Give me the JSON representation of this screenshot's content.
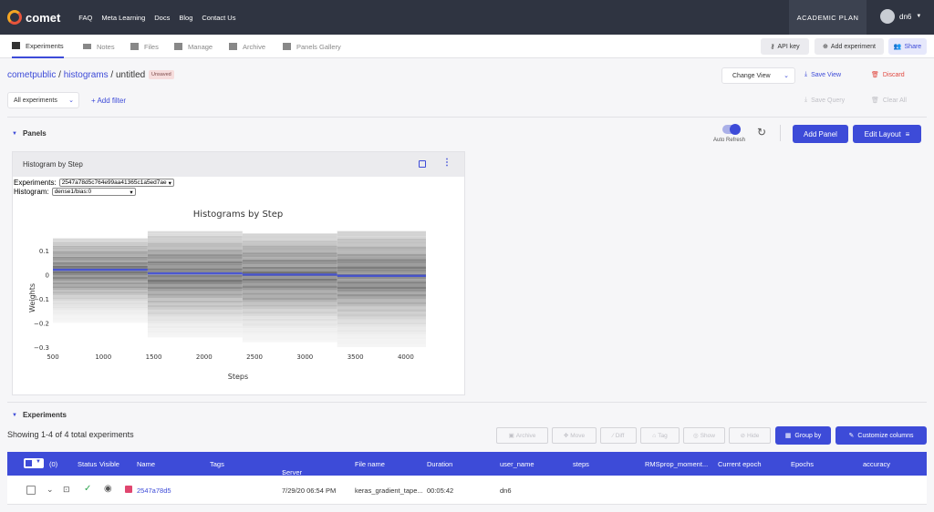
{
  "topnav": {
    "brand": "comet",
    "links": [
      "FAQ",
      "Meta Learning",
      "Docs",
      "Blog",
      "Contact Us"
    ],
    "plan": "ACADEMIC PLAN",
    "username": "dn6"
  },
  "tabs": [
    {
      "label": "Experiments",
      "icon": "bar-chart-icon",
      "active": true
    },
    {
      "label": "Notes",
      "icon": "notes-icon"
    },
    {
      "label": "Files",
      "icon": "folder-icon"
    },
    {
      "label": "Manage",
      "icon": "users-icon"
    },
    {
      "label": "Archive",
      "icon": "archive-icon"
    },
    {
      "label": "Panels Gallery",
      "icon": "grid-icon"
    }
  ],
  "toolbar": {
    "api_key": "API key",
    "add_experiment": "Add experiment",
    "share": "Share"
  },
  "breadcrumb": {
    "workspace": "cometpublic",
    "project": "histograms",
    "view": "untitled",
    "badge": "Unsaved",
    "sep": "/"
  },
  "view_actions": {
    "change_view": "Change View",
    "save_view": "Save View",
    "discard": "Discard",
    "save_query": "Save Query",
    "clear_all": "Clear All"
  },
  "filters": {
    "selected": "All experiments",
    "add_filter": "+ Add filter"
  },
  "panels_section": {
    "title": "Panels",
    "auto_refresh": "Auto Refresh",
    "auto_refresh_on": true,
    "add_panel": "Add Panel",
    "edit_layout": "Edit Layout"
  },
  "panel": {
    "title": "Histogram by Step",
    "experiments_label": "Experiments:",
    "experiments_value": "2547a78d5c764e99aa41365c1a5ed7ae",
    "histogram_label": "Histogram:",
    "histogram_value": "dense1/bias:0"
  },
  "chart_data": {
    "type": "heatmap",
    "title": "Histograms by Step",
    "xlabel": "Steps",
    "ylabel": "Weights",
    "x_ticks": [
      "500",
      "1000",
      "1500",
      "2000",
      "2500",
      "3000",
      "3500",
      "4000"
    ],
    "y_ticks": [
      "0.1",
      "0",
      "−0.1",
      "−0.2",
      "−0.3"
    ],
    "xlim": [
      500,
      4200
    ],
    "ylim": [
      -0.3,
      0.16
    ],
    "series": [
      {
        "x_start": 500,
        "x_end": 1440,
        "y_min": -0.2,
        "y_max": 0.15,
        "center": 0.02
      },
      {
        "x_start": 1440,
        "x_end": 2380,
        "y_min": -0.26,
        "y_max": 0.18,
        "center": 0.005
      },
      {
        "x_start": 2380,
        "x_end": 3320,
        "y_min": -0.28,
        "y_max": 0.17,
        "center": 0.0
      },
      {
        "x_start": 3320,
        "x_end": 4200,
        "y_min": -0.3,
        "y_max": 0.18,
        "center": -0.005
      }
    ]
  },
  "experiments_section": {
    "title": "Experiments",
    "summary": "Showing 1-4 of 4 total experiments",
    "actions": [
      "Archive",
      "Move",
      "Diff",
      "Tag",
      "Show",
      "Hide"
    ],
    "group_by": "Group by",
    "customize": "Customize columns"
  },
  "table": {
    "selected_count": "(0)",
    "columns": [
      "Status",
      "Visible",
      "Name",
      "Tags",
      "Server end time",
      "File name",
      "Duration",
      "user_name",
      "steps",
      "RMSprop_moment...",
      "Current epoch",
      "Epochs",
      "accuracy"
    ],
    "sort_arrow": "↓",
    "rows": [
      {
        "name": "2547a78d5",
        "tags": "",
        "server_end_time": "7/29/20 06:54 PM",
        "file_name": "keras_gradient_tape...",
        "duration": "00:05:42",
        "user_name": "dn6",
        "color": "#e0466f"
      }
    ]
  }
}
